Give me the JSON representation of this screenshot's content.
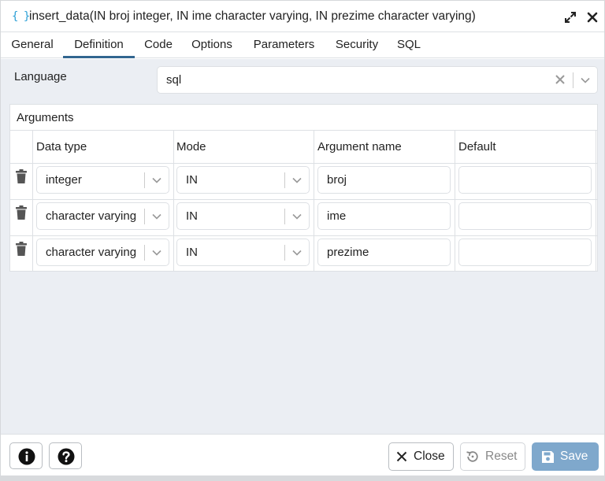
{
  "title": {
    "icon": "{ }",
    "text": "insert_data(IN broj integer, IN ime character varying, IN prezime character varying)"
  },
  "tabs": [
    {
      "label": "General"
    },
    {
      "label": "Definition",
      "active": true
    },
    {
      "label": "Code"
    },
    {
      "label": "Options"
    },
    {
      "label": "Parameters"
    },
    {
      "label": "Security"
    },
    {
      "label": "SQL"
    }
  ],
  "language": {
    "label": "Language",
    "value": "sql"
  },
  "arguments": {
    "title": "Arguments",
    "columns": [
      "Data type",
      "Mode",
      "Argument name",
      "Default"
    ],
    "rows": [
      {
        "data_type": "integer",
        "mode": "IN",
        "name": "broj",
        "default": ""
      },
      {
        "data_type": "character varying",
        "mode": "IN",
        "name": "ime",
        "default": ""
      },
      {
        "data_type": "character varying",
        "mode": "IN",
        "name": "prezime",
        "default": ""
      }
    ]
  },
  "footer": {
    "info_icon": "info-icon",
    "help_icon": "help-icon",
    "close_label": "Close",
    "reset_label": "Reset",
    "save_label": "Save"
  },
  "colors": {
    "accent": "#326690",
    "save_button": "#7fa8cc",
    "title_icon": "#2a9fd6"
  }
}
